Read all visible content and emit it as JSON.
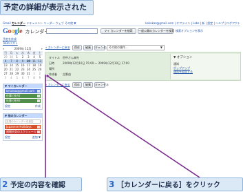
{
  "captions": {
    "top": "予定の詳細が表示された",
    "step2_num": "2",
    "step2_text": "予定の内容を確認",
    "step3_num": "3",
    "step3_text": "［カレンダーに戻る］をクリック"
  },
  "gbar": {
    "links": [
      "Gmail",
      "カレンダー",
      "ドキュメント",
      "リーダー",
      "ウェブ",
      "その他 ▼"
    ],
    "active": "カレンダー",
    "user": "kekakaz@gmail.com | オフライン | Labs | 新 | 設定 | ヘルプ | ログアウト"
  },
  "header": {
    "logo_letters": [
      "G",
      "o",
      "o",
      "g",
      "l",
      "e"
    ],
    "logo_suffix": "カレンダー",
    "search_mine": "マイ カレンダーを検索",
    "search_public": "一般公開のカレンダーを検索",
    "search_options": "検索オプションを表示"
  },
  "sidebar": {
    "create_event": "予定を作成",
    "tasks": "ToDoリスト",
    "mini_calendar": {
      "month": "2009年 12月",
      "nav_prev": "«",
      "nav_next": "»",
      "dow": [
        "日",
        "月",
        "火",
        "水",
        "木",
        "金",
        "土"
      ],
      "weeks": [
        [
          "29",
          "30",
          "1",
          "2",
          "3",
          "4",
          "5"
        ],
        [
          "6",
          "7",
          "8",
          "9",
          "10",
          "11",
          "12"
        ],
        [
          "13",
          "14",
          "15",
          "16",
          "17",
          "18",
          "19"
        ],
        [
          "20",
          "21",
          "22",
          "23",
          "24",
          "25",
          "26"
        ],
        [
          "27",
          "28",
          "29",
          "30",
          "31",
          "1",
          "2"
        ],
        [
          "3",
          "4",
          "5",
          "6",
          "7",
          "8",
          "9"
        ]
      ]
    },
    "my_calendars": {
      "title": "▼ マイカレンダー",
      "items": [
        {
          "label": "kekakaz@gmail.com",
          "color": "#5b7fd6"
        },
        {
          "label": "仕事 (社内)",
          "color": "#4f8f4a"
        },
        {
          "label": "仕事 (社外)",
          "color": "#4f8f4a"
        }
      ],
      "footer_left": "設定",
      "footer_right": "作成"
    },
    "other_calendars": {
      "title": "▼ 他のカレンダー",
      "input_placeholder": "友達のカレンダーを追加",
      "items": [
        {
          "label": "Japanese Holidays",
          "color": "#d8502a"
        },
        {
          "label": "週間天気のスケジュール",
          "color": "#c7362f"
        }
      ],
      "footer_left": "設定",
      "footer_right": "追加 ▼"
    }
  },
  "main": {
    "back_link": "« カレンダーに戻る",
    "save": "保存",
    "discard": "破棄",
    "cancel": "キャンセル",
    "other_actions": "その他の操作...",
    "other_actions_arrow": "▼",
    "fields": [
      {
        "key": "タイトル",
        "value": "田中さん来社"
      },
      {
        "key": "日時",
        "value": "2009年12月10日 15:00 ～ 2009年12月10日 17:00"
      },
      {
        "key": "場所",
        "value": ""
      },
      {
        "key": "作成者",
        "value": "吉野由"
      }
    ],
    "options": {
      "heading": "▼ オプション",
      "notify_title": "通知",
      "notify_link1": "ポップアップ",
      "notify_link2": "通知を追加する"
    }
  }
}
